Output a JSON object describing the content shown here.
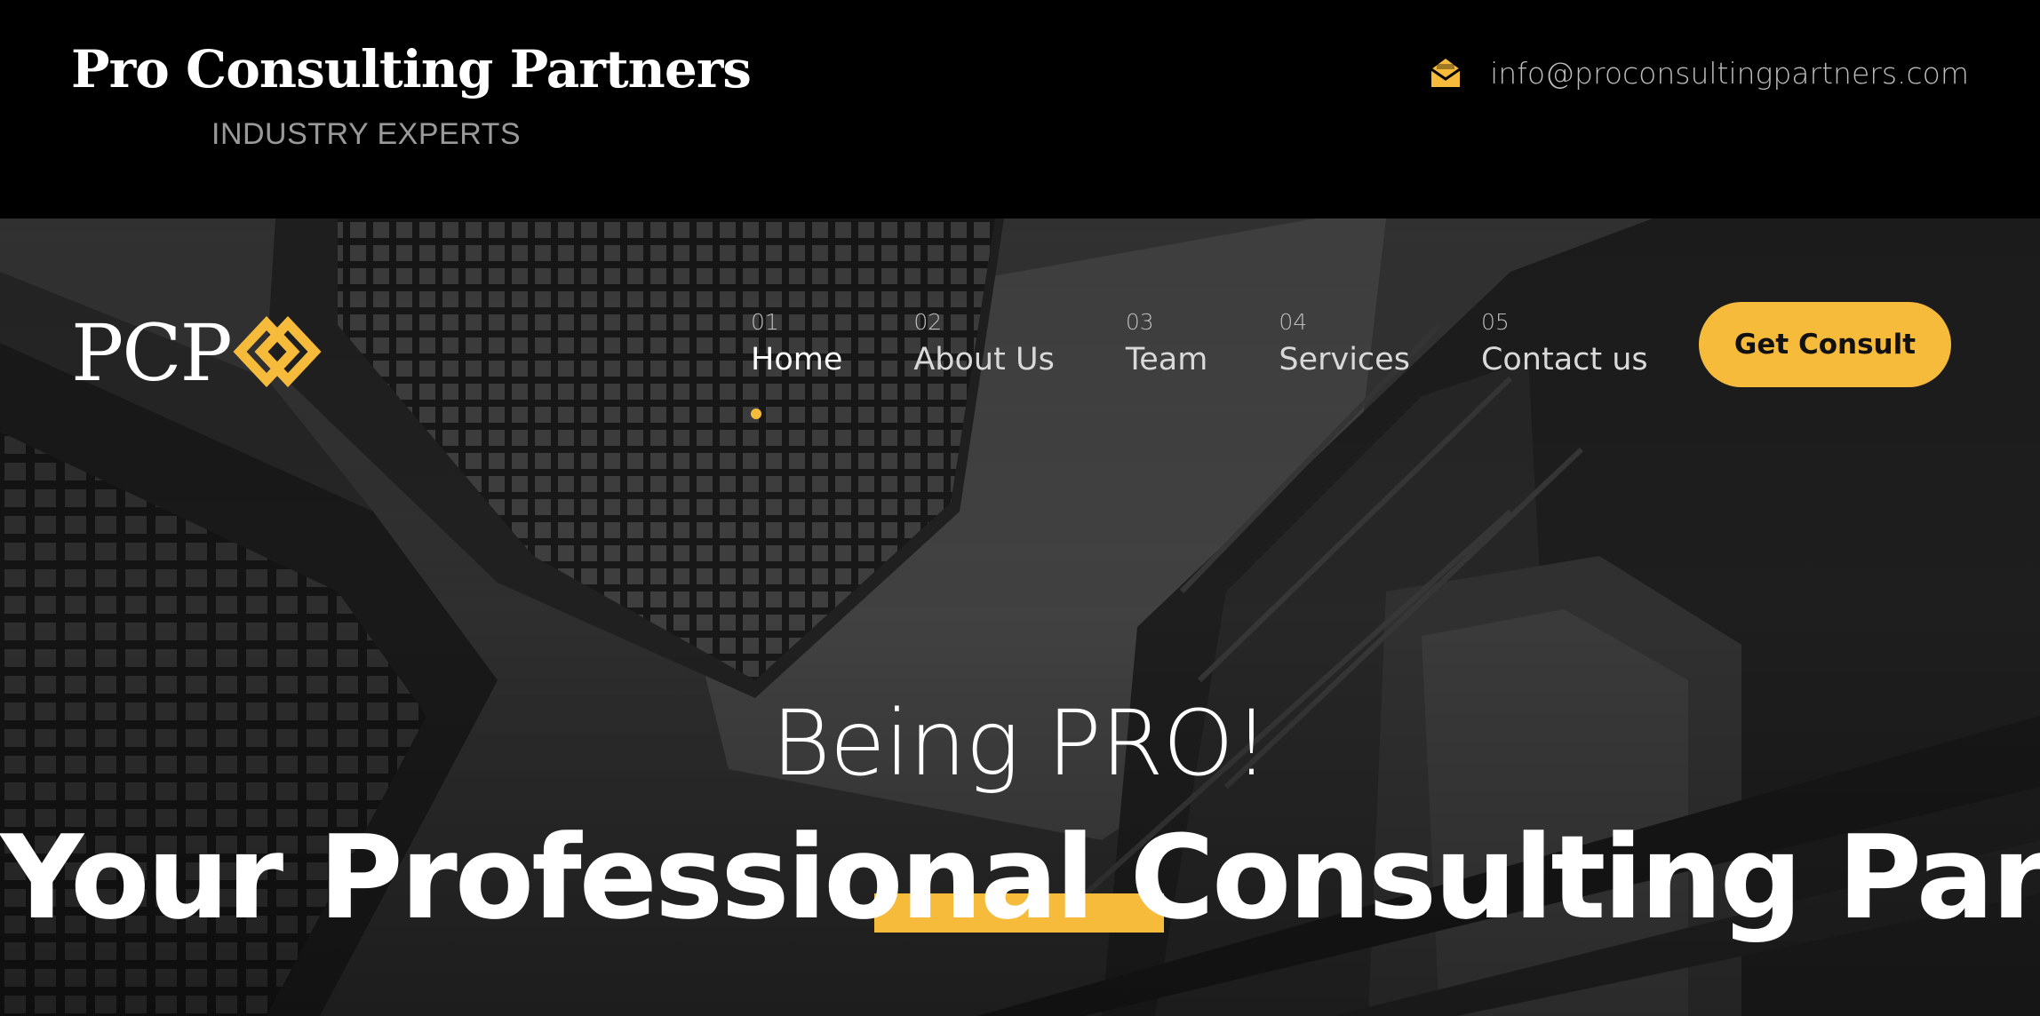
{
  "header": {
    "brand_name": "Pro Consulting Partners",
    "tagline": "INDUSTRY EXPERTS",
    "email": "info@proconsultingpartners.com",
    "email_icon": "envelope-open-icon"
  },
  "navbar": {
    "logo_text": "PCP",
    "logo_mark": "interlocking-diamond-icon",
    "items": [
      {
        "num": "01",
        "label": "Home",
        "active": true
      },
      {
        "num": "02",
        "label": "About Us"
      },
      {
        "num": "03",
        "label": "Team"
      },
      {
        "num": "04",
        "label": "Services"
      },
      {
        "num": "05",
        "label": "Contact us"
      }
    ],
    "cta_label": "Get Consult"
  },
  "hero": {
    "subtitle": "Being PRO!",
    "title": "Your Professional Consulting Partners"
  },
  "colors": {
    "accent": "#f6bb3b",
    "background": "#000000",
    "text": "#ffffff",
    "muted": "#9a9a9a"
  }
}
